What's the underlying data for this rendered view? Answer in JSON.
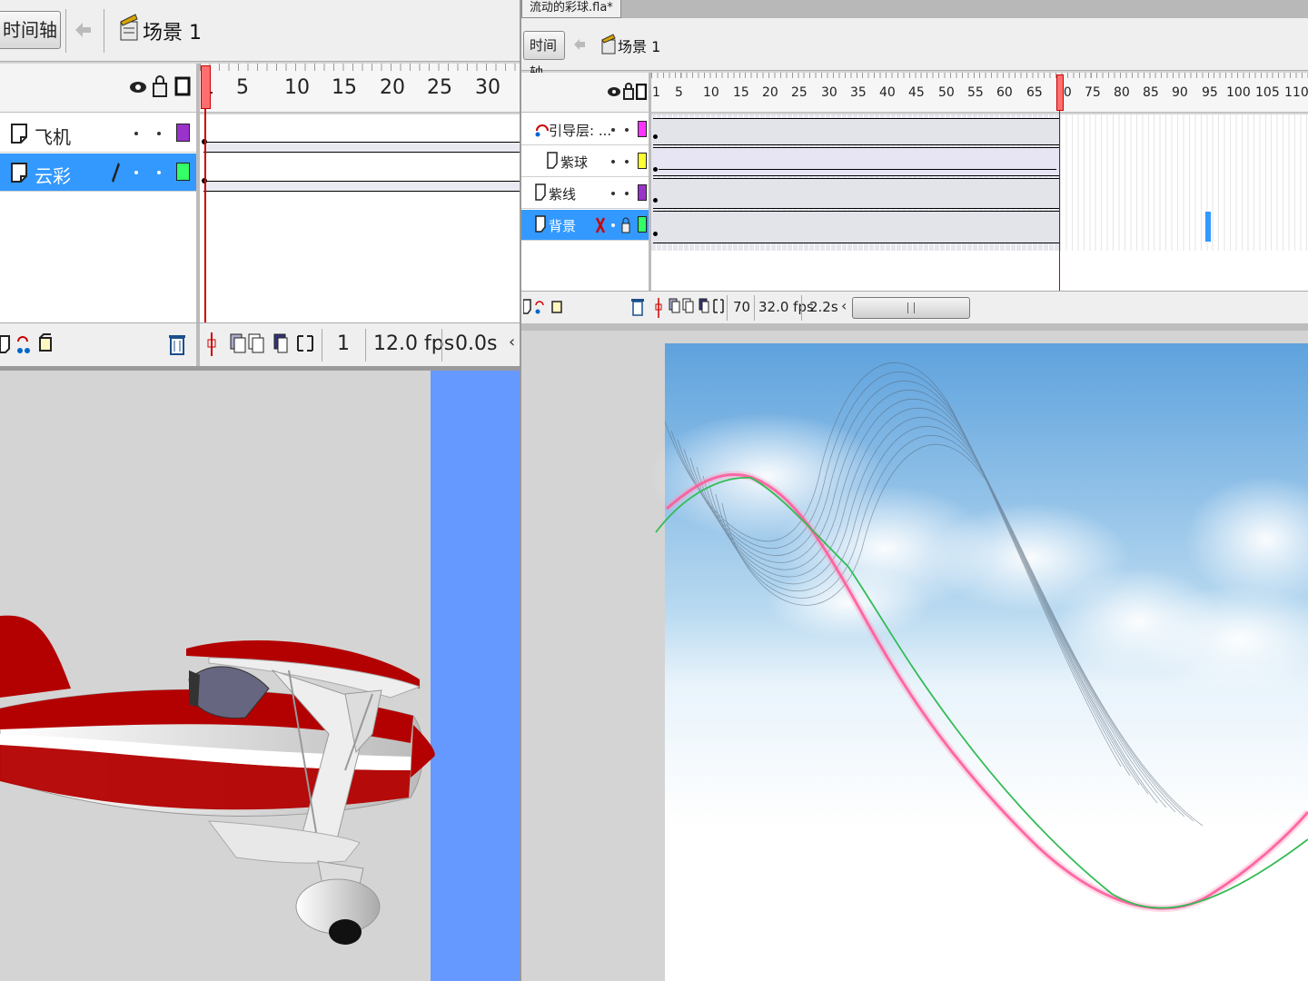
{
  "left_window": {
    "timeline_button": "时间轴",
    "scene_label": "场景 1",
    "ruler_ticks": [
      "1",
      "5",
      "10",
      "15",
      "20",
      "25",
      "30"
    ],
    "layers": [
      {
        "name": "飞机",
        "color": "#9933cc",
        "selected": false
      },
      {
        "name": "云彩",
        "color": "#33ff66",
        "selected": true
      }
    ],
    "footer": {
      "current_frame": "1",
      "frame_rate": "12.0 fps",
      "elapsed_time": "0.0s"
    }
  },
  "right_window": {
    "document_tab": "流动的彩球.fla*",
    "timeline_button": "时间轴",
    "scene_label": "场景 1",
    "ruler_ticks": [
      "1",
      "5",
      "10",
      "15",
      "20",
      "25",
      "30",
      "35",
      "40",
      "45",
      "50",
      "55",
      "60",
      "65",
      "70",
      "75",
      "80",
      "85",
      "90",
      "95",
      "100",
      "105",
      "110"
    ],
    "layers": [
      {
        "name": "引导层: ...",
        "color": "#ff33ff",
        "selected": false
      },
      {
        "name": "紫球",
        "color": "#ffff33",
        "selected": false
      },
      {
        "name": "紫线",
        "color": "#9933cc",
        "selected": false
      },
      {
        "name": "背景",
        "color": "#33ff66",
        "selected": true
      }
    ],
    "footer": {
      "current_frame": "70",
      "frame_rate": "32.0 fps",
      "elapsed_time": "2.2s"
    }
  },
  "colors": {
    "selection": "#3399ff",
    "stage_blue": "#6699ff",
    "plane_red": "#b30000",
    "guide_pink": "#ff3388",
    "guide_green": "#33bb55"
  }
}
